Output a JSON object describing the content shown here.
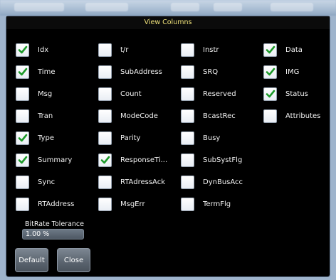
{
  "window_title": "View Columns",
  "columns": [
    {
      "label": "Idx",
      "checked": true
    },
    {
      "label": "Time",
      "checked": true
    },
    {
      "label": "Msg",
      "checked": false
    },
    {
      "label": "Tran",
      "checked": false
    },
    {
      "label": "Type",
      "checked": true
    },
    {
      "label": "Summary",
      "checked": true
    },
    {
      "label": "Sync",
      "checked": false
    },
    {
      "label": "RTAddress",
      "checked": false
    },
    {
      "label": "t/r",
      "checked": false
    },
    {
      "label": "SubAddress",
      "checked": false
    },
    {
      "label": "Count",
      "checked": false
    },
    {
      "label": "ModeCode",
      "checked": false
    },
    {
      "label": "Parity",
      "checked": false
    },
    {
      "label": "ResponseTi...",
      "checked": true
    },
    {
      "label": "RTAdressAck",
      "checked": false
    },
    {
      "label": "MsgErr",
      "checked": false
    },
    {
      "label": "Instr",
      "checked": false
    },
    {
      "label": "SRQ",
      "checked": false
    },
    {
      "label": "Reserved",
      "checked": false
    },
    {
      "label": "BcastRec",
      "checked": false
    },
    {
      "label": "Busy",
      "checked": false
    },
    {
      "label": "SubSystFlg",
      "checked": false
    },
    {
      "label": "DynBusAcc",
      "checked": false
    },
    {
      "label": "TermFlg",
      "checked": false
    },
    {
      "label": "Data",
      "checked": true
    },
    {
      "label": "IMG",
      "checked": true
    },
    {
      "label": "Status",
      "checked": true
    },
    {
      "label": "Attributes",
      "checked": false
    }
  ],
  "tolerance": {
    "label": "BitRate Tolerance",
    "value": "1.00 %"
  },
  "buttons": {
    "default_label": "Default",
    "close_label": "Close"
  },
  "colors": {
    "title": "#f0e27a",
    "check": "#1d9a2a",
    "background": "#000000"
  }
}
